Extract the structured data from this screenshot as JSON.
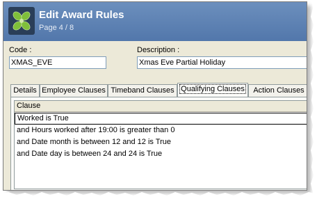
{
  "window": {
    "title": "Edit Award Rules",
    "page_indicator": "Page 4 / 8"
  },
  "form": {
    "code_label": "Code :",
    "code_value": "XMAS_EVE",
    "description_label": "Description :",
    "description_value": "Xmas Eve Partial Holiday"
  },
  "tabs": [
    {
      "label": "Details"
    },
    {
      "label": "Employee Clauses"
    },
    {
      "label": "Timeband Clauses"
    },
    {
      "label": "Qualifying Clauses"
    },
    {
      "label": "Action Clauses"
    }
  ],
  "active_tab": "Qualifying Clauses",
  "grid": {
    "column_header": "Clause",
    "rows": [
      "Worked is True",
      "and Hours worked after 19:00 is greater than 0",
      "and Date month is between 12 and  12 is True",
      "and Date day is between 24 and  24 is True"
    ]
  },
  "colors": {
    "titlebar": "#5a7fb3",
    "window_bg": "#ece9d8",
    "logo_bg": "#2a3e58",
    "logo_leaf": "#7fbf3a"
  },
  "icons": {
    "app_logo": "leaf-cross-logo-icon"
  }
}
